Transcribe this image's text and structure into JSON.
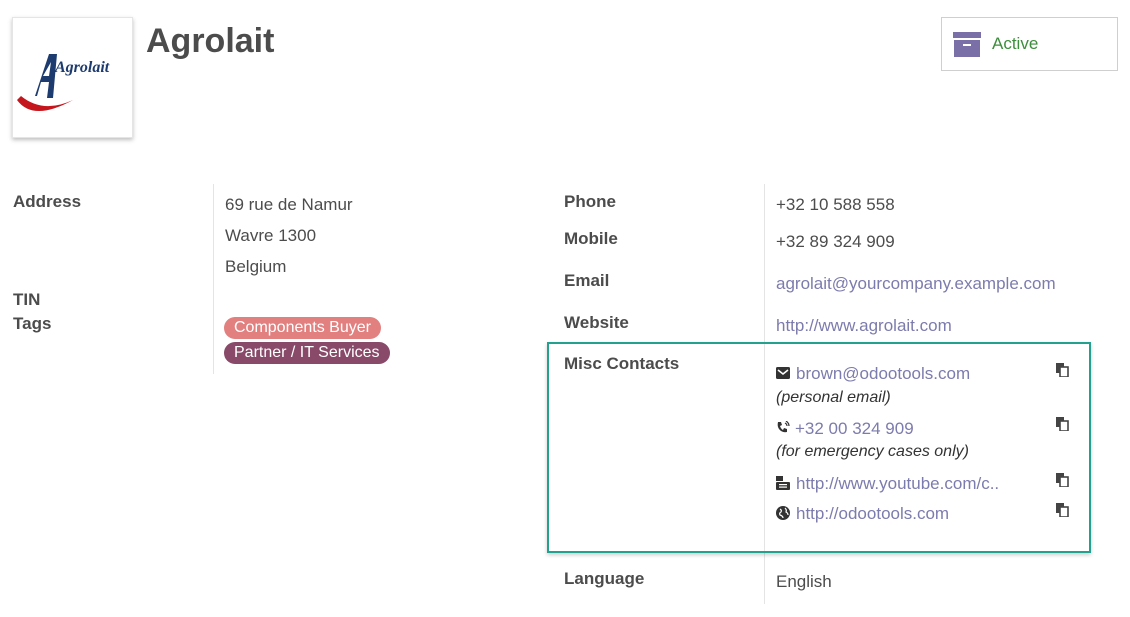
{
  "partner": {
    "name": "Agrolait",
    "logo_text": "Agrolait",
    "status_button": {
      "label": "Active",
      "icon": "archive-icon"
    }
  },
  "left": {
    "address_label": "Address",
    "address_lines": [
      "69 rue de Namur",
      "Wavre 1300",
      "Belgium"
    ],
    "tin_label": "TIN",
    "tags_label": "Tags",
    "tags": [
      {
        "label": "Components Buyer",
        "color": "#e27f7f"
      },
      {
        "label": "Partner / IT Services",
        "color": "#884a68"
      }
    ]
  },
  "right": {
    "phone_label": "Phone",
    "phone": "+32 10 588 558",
    "mobile_label": "Mobile",
    "mobile": "+32 89 324 909",
    "email_label": "Email",
    "email": "agrolait@yourcompany.example.com",
    "website_label": "Website",
    "website": "http://www.agrolait.com",
    "misc_label": "Misc Contacts",
    "misc": [
      {
        "icon": "envelope-icon",
        "value": "brown@odootools.com",
        "note": "(personal email)"
      },
      {
        "icon": "phone-volume-icon",
        "value": "+32 00 324 909",
        "note": "(for emergency cases only)"
      },
      {
        "icon": "youtube-icon",
        "value": "http://www.youtube.com/c.."
      },
      {
        "icon": "globe-icon",
        "value": "http://odootools.com"
      }
    ],
    "language_label": "Language",
    "language": "English"
  },
  "colors": {
    "link": "#7c7bad",
    "misc_border": "#24a08e",
    "active_text": "#3c8d3c",
    "archive_icon": "#7b6fa7"
  }
}
